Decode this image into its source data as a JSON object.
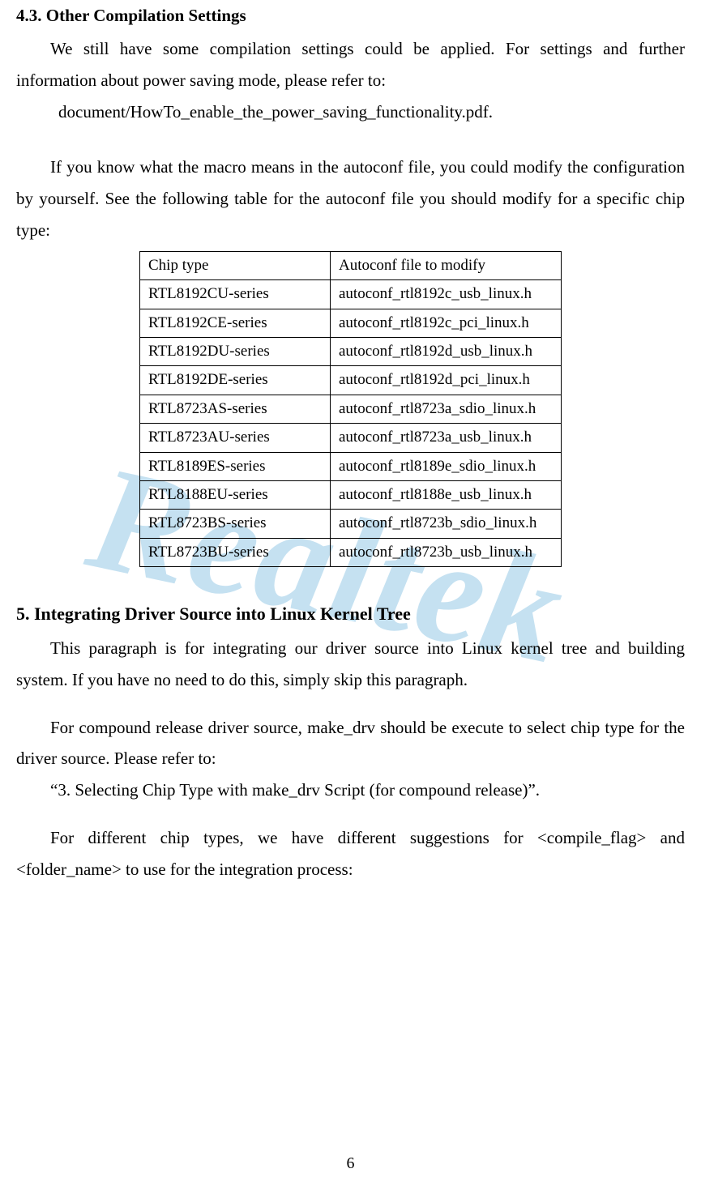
{
  "watermark": "Realtek",
  "sec43": {
    "heading": "4.3.    Other Compilation Settings",
    "p1": "We still have some compilation settings could be applied. For settings and further information about power saving mode, please refer to:",
    "p1_path": "document/HowTo_enable_the_power_saving_functionality.pdf.",
    "p2": "If you know what the macro means in the autoconf file, you could modify the configuration by yourself. See the following table for the autoconf file you should modify for a specific chip type:"
  },
  "table43": {
    "header": {
      "chip": "Chip type",
      "file": "Autoconf file to modify"
    },
    "rows": [
      {
        "chip": "RTL8192CU-series",
        "file": "autoconf_rtl8192c_usb_linux.h"
      },
      {
        "chip": "RTL8192CE-series",
        "file": "autoconf_rtl8192c_pci_linux.h"
      },
      {
        "chip": "RTL8192DU-series",
        "file": "autoconf_rtl8192d_usb_linux.h"
      },
      {
        "chip": "RTL8192DE-series",
        "file": "autoconf_rtl8192d_pci_linux.h"
      },
      {
        "chip": "RTL8723AS-series",
        "file": "autoconf_rtl8723a_sdio_linux.h"
      },
      {
        "chip": "RTL8723AU-series",
        "file": "autoconf_rtl8723a_usb_linux.h"
      },
      {
        "chip": "RTL8189ES-series",
        "file": "autoconf_rtl8189e_sdio_linux.h"
      },
      {
        "chip": "RTL8188EU-series",
        "file": "autoconf_rtl8188e_usb_linux.h"
      },
      {
        "chip": "RTL8723BS-series",
        "file": "autoconf_rtl8723b_sdio_linux.h"
      },
      {
        "chip": "RTL8723BU-series",
        "file": "autoconf_rtl8723b_usb_linux.h"
      }
    ]
  },
  "sec5": {
    "heading": "5.    Integrating Driver Source into Linux Kernel Tree",
    "p1": "This paragraph is for integrating our driver source into Linux kernel tree and building system. If you have no need to do this, simply skip this paragraph.",
    "p2": "For compound release driver source, make_drv should be execute to select chip type for the driver source. Please refer to:",
    "p2_ref": "“3. Selecting Chip Type with make_drv Script (for compound release)”.",
    "p3": "For different chip types, we have different suggestions for <compile_flag> and <folder_name> to use for the integration process:"
  },
  "page_number": "6"
}
